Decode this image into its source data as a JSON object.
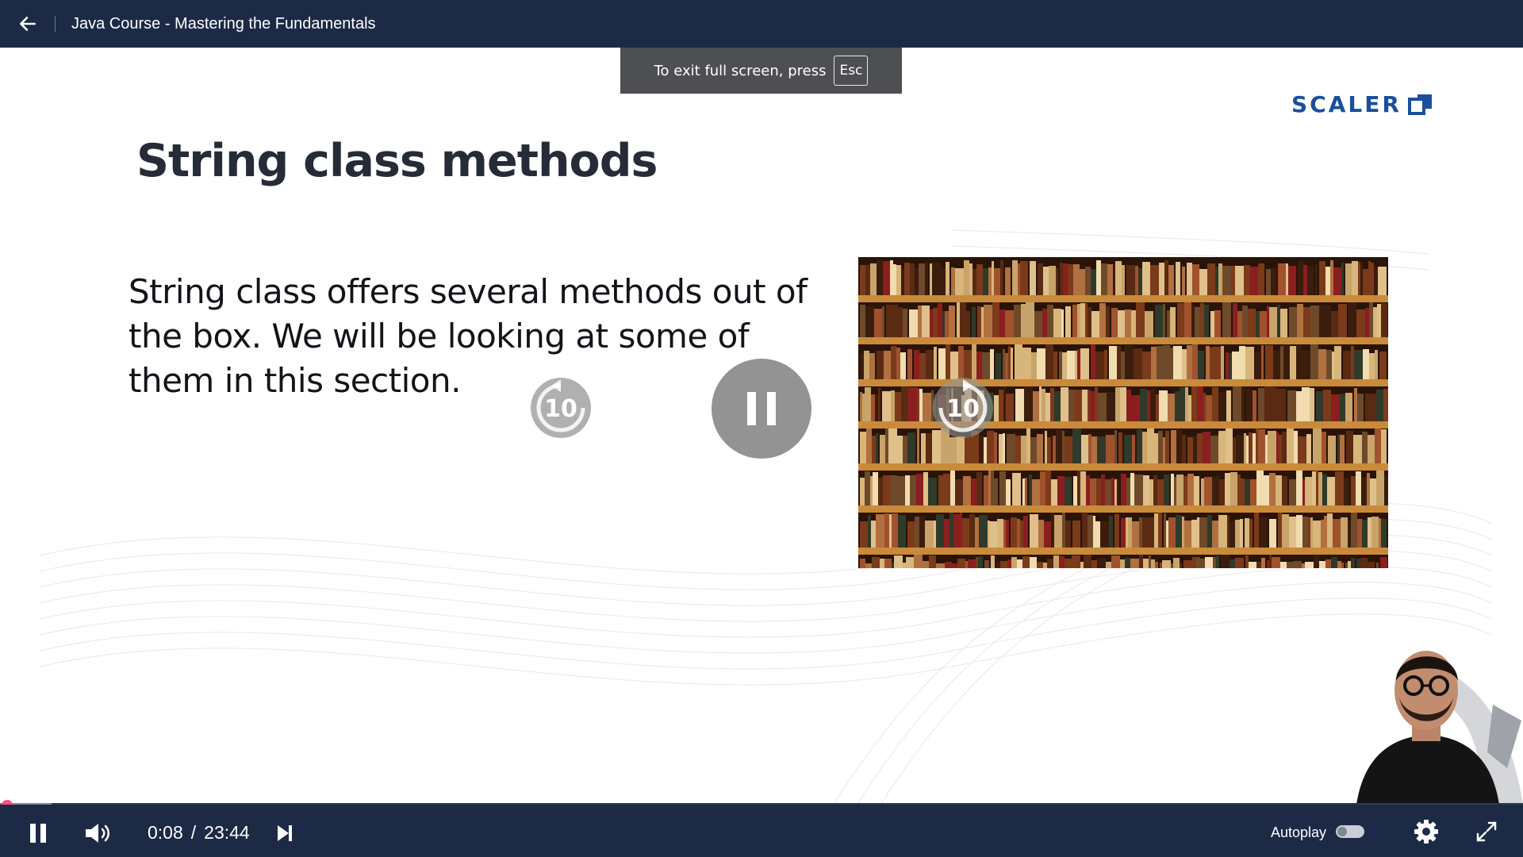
{
  "header": {
    "course_title": "Java Course - Mastering the Fundamentals",
    "back_icon": "arrow-left-icon"
  },
  "fullscreen_toast": {
    "message": "To exit full screen, press",
    "key": "Esc"
  },
  "slide": {
    "brand": "SCALER",
    "title": "String class methods",
    "body": "String class offers several methods out of the box. We will be looking at some of them in this section.",
    "image": "bookshelf-image"
  },
  "overlay": {
    "rewind_label": "10",
    "forward_label": "10",
    "center_icon": "pause-icon"
  },
  "controls": {
    "current_time": "0:08",
    "separator": "/",
    "duration": "23:44",
    "autoplay_label": "Autoplay",
    "autoplay_on": false,
    "progress_fraction": 0.0057,
    "buffer_fraction": 0.034,
    "icons": [
      "pause-icon",
      "volume-icon",
      "next-icon",
      "settings-icon",
      "fullscreen-icon"
    ]
  },
  "colors": {
    "bar": "#1c2a46",
    "brand": "#1a4fa0",
    "progress": "#e23b6a"
  }
}
